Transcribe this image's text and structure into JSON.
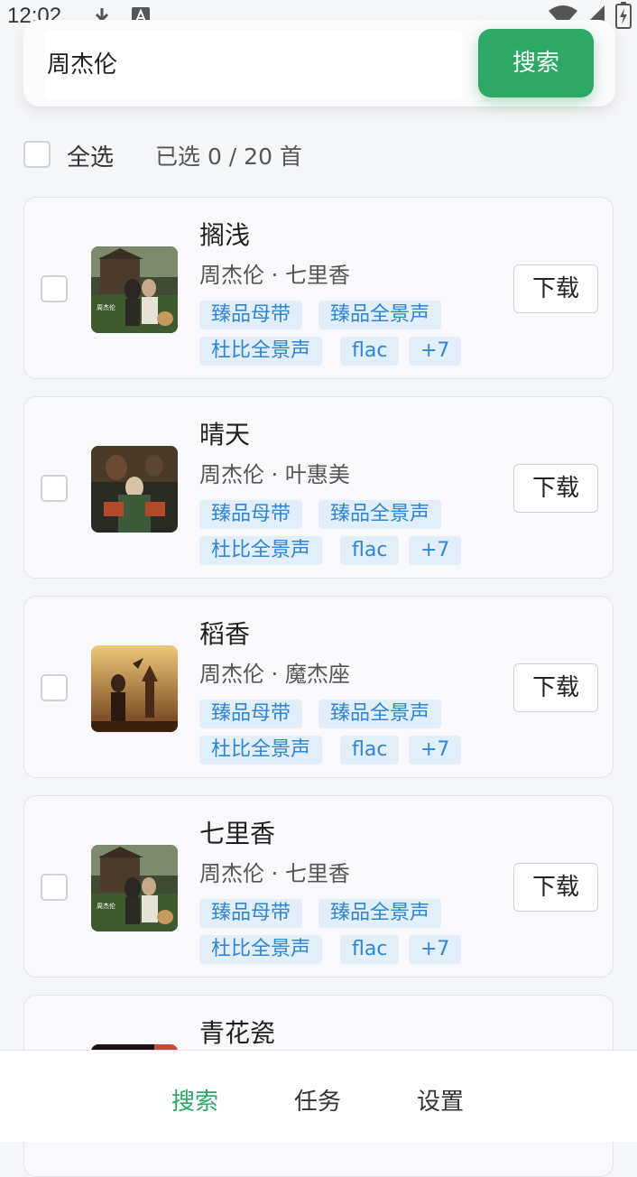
{
  "status_bar": {
    "time": "12:02",
    "icons": [
      "download-icon",
      "text-a-icon",
      "wifi-icon",
      "signal-icon",
      "battery-charging-icon"
    ]
  },
  "search": {
    "value": "周杰伦",
    "button_label": "搜索"
  },
  "selection": {
    "select_all_label": "全选",
    "count_text": "已选 0 / 20 首",
    "checked": false
  },
  "songs": [
    {
      "title": "搁浅",
      "subtitle": "周杰伦 · 七里香",
      "tags": [
        "臻品母带",
        "臻品全景声",
        "杜比全景声",
        "flac",
        "+7"
      ],
      "download_label": "下载",
      "cover": "qilixiang-cover"
    },
    {
      "title": "晴天",
      "subtitle": "周杰伦 · 叶惠美",
      "tags": [
        "臻品母带",
        "臻品全景声",
        "杜比全景声",
        "flac",
        "+7"
      ],
      "download_label": "下载",
      "cover": "yehuimei-cover"
    },
    {
      "title": "稻香",
      "subtitle": "周杰伦 · 魔杰座",
      "tags": [
        "臻品母带",
        "臻品全景声",
        "杜比全景声",
        "flac",
        "+7"
      ],
      "download_label": "下载",
      "cover": "mojiezuo-cover"
    },
    {
      "title": "七里香",
      "subtitle": "周杰伦 · 七里香",
      "tags": [
        "臻品母带",
        "臻品全景声",
        "杜比全景声",
        "flac",
        "+7"
      ],
      "download_label": "下载",
      "cover": "qilixiang-cover"
    },
    {
      "title": "青花瓷",
      "subtitle": "",
      "tags": [],
      "download_label": "",
      "cover": "qinghuaci-cover"
    }
  ],
  "bottom_nav": {
    "items": [
      {
        "label": "搜索",
        "active": true
      },
      {
        "label": "任务",
        "active": false
      },
      {
        "label": "设置",
        "active": false
      }
    ]
  },
  "colors": {
    "accent": "#2ea866",
    "tag_bg": "#e2eef9",
    "tag_text": "#2f86d2",
    "background": "#f5f6f8"
  }
}
